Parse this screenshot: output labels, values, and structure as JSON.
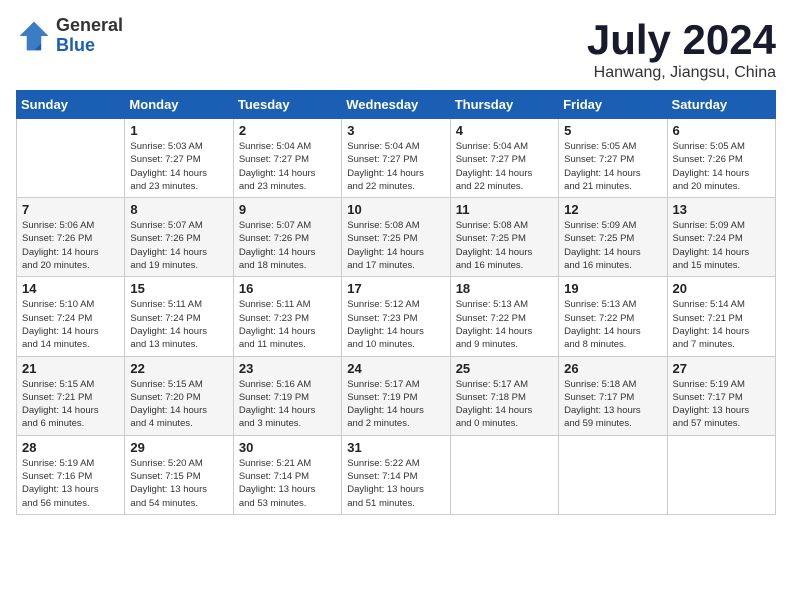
{
  "header": {
    "logo_general": "General",
    "logo_blue": "Blue",
    "title": "July 2024",
    "subtitle": "Hanwang, Jiangsu, China"
  },
  "weekdays": [
    "Sunday",
    "Monday",
    "Tuesday",
    "Wednesday",
    "Thursday",
    "Friday",
    "Saturday"
  ],
  "weeks": [
    [
      {
        "day": "",
        "info": ""
      },
      {
        "day": "1",
        "info": "Sunrise: 5:03 AM\nSunset: 7:27 PM\nDaylight: 14 hours\nand 23 minutes."
      },
      {
        "day": "2",
        "info": "Sunrise: 5:04 AM\nSunset: 7:27 PM\nDaylight: 14 hours\nand 23 minutes."
      },
      {
        "day": "3",
        "info": "Sunrise: 5:04 AM\nSunset: 7:27 PM\nDaylight: 14 hours\nand 22 minutes."
      },
      {
        "day": "4",
        "info": "Sunrise: 5:04 AM\nSunset: 7:27 PM\nDaylight: 14 hours\nand 22 minutes."
      },
      {
        "day": "5",
        "info": "Sunrise: 5:05 AM\nSunset: 7:27 PM\nDaylight: 14 hours\nand 21 minutes."
      },
      {
        "day": "6",
        "info": "Sunrise: 5:05 AM\nSunset: 7:26 PM\nDaylight: 14 hours\nand 20 minutes."
      }
    ],
    [
      {
        "day": "7",
        "info": "Sunrise: 5:06 AM\nSunset: 7:26 PM\nDaylight: 14 hours\nand 20 minutes."
      },
      {
        "day": "8",
        "info": "Sunrise: 5:07 AM\nSunset: 7:26 PM\nDaylight: 14 hours\nand 19 minutes."
      },
      {
        "day": "9",
        "info": "Sunrise: 5:07 AM\nSunset: 7:26 PM\nDaylight: 14 hours\nand 18 minutes."
      },
      {
        "day": "10",
        "info": "Sunrise: 5:08 AM\nSunset: 7:25 PM\nDaylight: 14 hours\nand 17 minutes."
      },
      {
        "day": "11",
        "info": "Sunrise: 5:08 AM\nSunset: 7:25 PM\nDaylight: 14 hours\nand 16 minutes."
      },
      {
        "day": "12",
        "info": "Sunrise: 5:09 AM\nSunset: 7:25 PM\nDaylight: 14 hours\nand 16 minutes."
      },
      {
        "day": "13",
        "info": "Sunrise: 5:09 AM\nSunset: 7:24 PM\nDaylight: 14 hours\nand 15 minutes."
      }
    ],
    [
      {
        "day": "14",
        "info": "Sunrise: 5:10 AM\nSunset: 7:24 PM\nDaylight: 14 hours\nand 14 minutes."
      },
      {
        "day": "15",
        "info": "Sunrise: 5:11 AM\nSunset: 7:24 PM\nDaylight: 14 hours\nand 13 minutes."
      },
      {
        "day": "16",
        "info": "Sunrise: 5:11 AM\nSunset: 7:23 PM\nDaylight: 14 hours\nand 11 minutes."
      },
      {
        "day": "17",
        "info": "Sunrise: 5:12 AM\nSunset: 7:23 PM\nDaylight: 14 hours\nand 10 minutes."
      },
      {
        "day": "18",
        "info": "Sunrise: 5:13 AM\nSunset: 7:22 PM\nDaylight: 14 hours\nand 9 minutes."
      },
      {
        "day": "19",
        "info": "Sunrise: 5:13 AM\nSunset: 7:22 PM\nDaylight: 14 hours\nand 8 minutes."
      },
      {
        "day": "20",
        "info": "Sunrise: 5:14 AM\nSunset: 7:21 PM\nDaylight: 14 hours\nand 7 minutes."
      }
    ],
    [
      {
        "day": "21",
        "info": "Sunrise: 5:15 AM\nSunset: 7:21 PM\nDaylight: 14 hours\nand 6 minutes."
      },
      {
        "day": "22",
        "info": "Sunrise: 5:15 AM\nSunset: 7:20 PM\nDaylight: 14 hours\nand 4 minutes."
      },
      {
        "day": "23",
        "info": "Sunrise: 5:16 AM\nSunset: 7:19 PM\nDaylight: 14 hours\nand 3 minutes."
      },
      {
        "day": "24",
        "info": "Sunrise: 5:17 AM\nSunset: 7:19 PM\nDaylight: 14 hours\nand 2 minutes."
      },
      {
        "day": "25",
        "info": "Sunrise: 5:17 AM\nSunset: 7:18 PM\nDaylight: 14 hours\nand 0 minutes."
      },
      {
        "day": "26",
        "info": "Sunrise: 5:18 AM\nSunset: 7:17 PM\nDaylight: 13 hours\nand 59 minutes."
      },
      {
        "day": "27",
        "info": "Sunrise: 5:19 AM\nSunset: 7:17 PM\nDaylight: 13 hours\nand 57 minutes."
      }
    ],
    [
      {
        "day": "28",
        "info": "Sunrise: 5:19 AM\nSunset: 7:16 PM\nDaylight: 13 hours\nand 56 minutes."
      },
      {
        "day": "29",
        "info": "Sunrise: 5:20 AM\nSunset: 7:15 PM\nDaylight: 13 hours\nand 54 minutes."
      },
      {
        "day": "30",
        "info": "Sunrise: 5:21 AM\nSunset: 7:14 PM\nDaylight: 13 hours\nand 53 minutes."
      },
      {
        "day": "31",
        "info": "Sunrise: 5:22 AM\nSunset: 7:14 PM\nDaylight: 13 hours\nand 51 minutes."
      },
      {
        "day": "",
        "info": ""
      },
      {
        "day": "",
        "info": ""
      },
      {
        "day": "",
        "info": ""
      }
    ]
  ]
}
